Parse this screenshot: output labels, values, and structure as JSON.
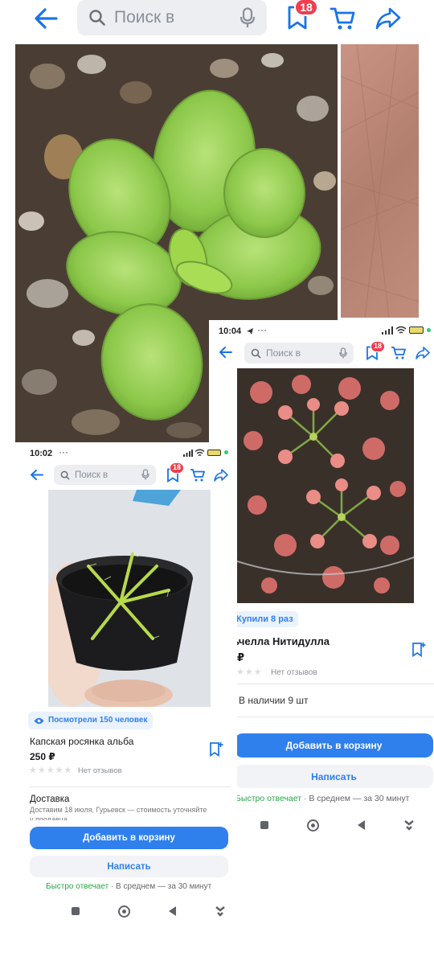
{
  "main_header": {
    "search_placeholder": "Поиск в",
    "favorites_badge": "18"
  },
  "screen_right": {
    "status_time": "10:04",
    "search_placeholder": "Поиск в",
    "favorites_badge": "18",
    "purchases_label": "Купили 8 раз",
    "title": "ьчелла Нитидулла",
    "price": "₽",
    "reviews": "Нет отзывов",
    "stock": "В наличии 9 шт",
    "add_to_cart": "Добавить в корзину",
    "write": "Написать",
    "fast_reply": "Быстро отвечает",
    "reply_time": "· В среднем  — за 30 минут"
  },
  "screen_left": {
    "status_time": "10:02",
    "search_placeholder": "Поиск в",
    "favorites_badge": "18",
    "views_label": "Посмотрели 150 человек",
    "title": "Капская росянка альба",
    "price": "250 ₽",
    "reviews": "Нет отзывов",
    "delivery_title": "Доставка",
    "delivery_text": "Доставим 18 июля, Гурьевск — стоимость уточняйте",
    "delivery_text2": "у продавца",
    "add_to_cart": "Добавить в корзину",
    "write": "Написать",
    "fast_reply": "Быстро отвечает",
    "reply_time": "· В среднем  — за 30 минут"
  },
  "colors": {
    "accent": "#2f80ed",
    "badge": "#f03d4f",
    "green": "#28a745"
  }
}
